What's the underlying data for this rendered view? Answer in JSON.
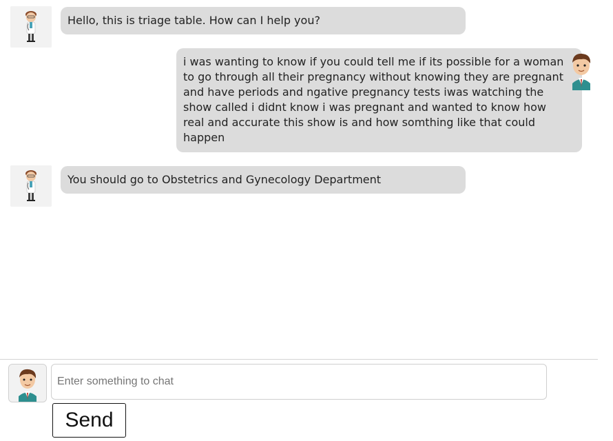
{
  "messages": [
    {
      "sender": "bot",
      "avatar": "doctor-avatar",
      "text": "Hello, this is triage table. How can I help you?"
    },
    {
      "sender": "user",
      "avatar": "user-avatar",
      "text": "i was wanting to know if you could tell me if its possible for a woman to go through all their pregnancy without knowing they are pregnant and have periods and ngative pregnancy tests iwas watching the show called i didnt know i was pregnant and wanted to know how real and accurate this show is and how somthing like that could happen"
    },
    {
      "sender": "bot",
      "avatar": "doctor-avatar",
      "text": "You should go to Obstetrics and Gynecology Department"
    }
  ],
  "composer": {
    "avatar": "user-avatar",
    "placeholder": "Enter something to chat",
    "value": "",
    "send_label": "Send"
  },
  "colors": {
    "bubble_bg": "#dcdcdc",
    "avatar_bg": "#f2f2f2",
    "divider": "#d4d4d4"
  }
}
